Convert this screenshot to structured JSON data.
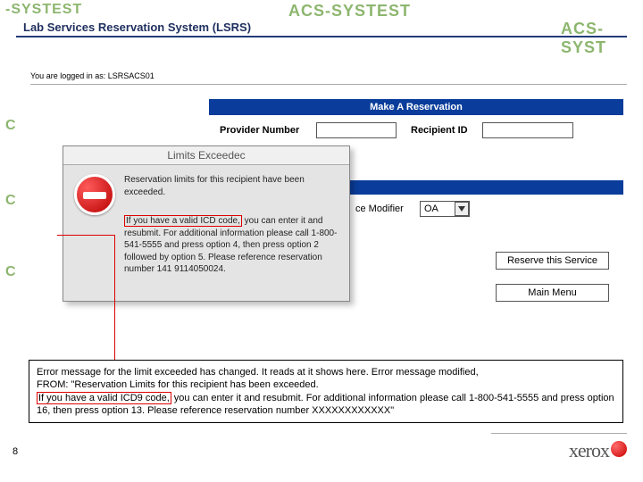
{
  "watermarks": {
    "a": "C",
    "b": "-SYSTEST",
    "c": "C",
    "d": "C",
    "e": "ACS-SYSTEST",
    "f": "ACS-SYST"
  },
  "lab_title": "Lab Services Reservation System (LSRS)",
  "login_text": "You are logged in as: LSRSACS01",
  "header_bar": "Make A Reservation",
  "fields": {
    "provider": "Provider Number",
    "recipient": "Recipient ID",
    "ce_mod": "ce Modifier",
    "oa": "OA"
  },
  "dialog": {
    "title": "Limits Exceedec",
    "p1": "Reservation limits for this recipient have been exceeded.",
    "p2a": "If you have a valid ICD code,",
    "p2b": " you can enter it and resubmit. For additional information please call 1-800-541-5555 and press option 4, then press option 2 followed by option 5. Please reference reservation number 141 9114050024."
  },
  "buttons": {
    "reserve": "Reserve this Service",
    "menu": "Main Menu"
  },
  "caption": {
    "l1": "Error message for the limit exceeded has changed. It reads at it shows here. Error message modified,",
    "l2": "FROM: \"Reservation Limits for this recipient has been exceeded.",
    "hi": "If you have a valid ICD9 code,",
    "l3": " you can enter it and resubmit. For additional information please call 1-800-541-5555 and press option 16, then press option 13. Please reference reservation number XXXXXXXXXXXX\""
  },
  "page": "8",
  "footer_text": "xerox"
}
